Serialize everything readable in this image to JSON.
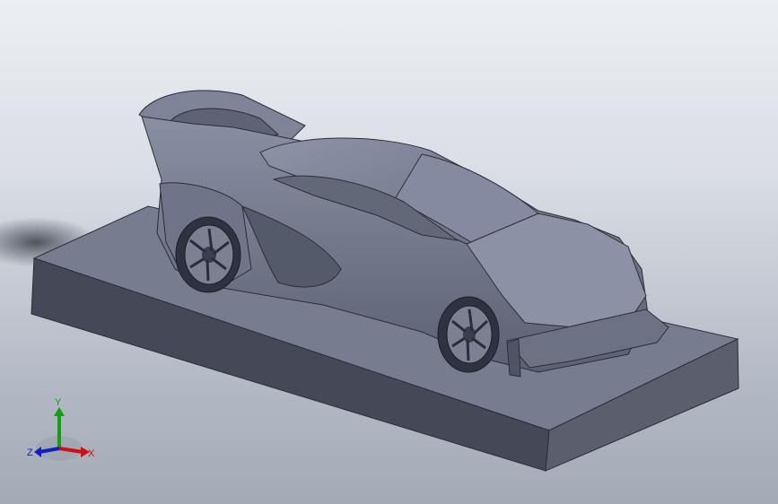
{
  "viewport": {
    "background_top": "#eceff3",
    "background_bottom": "#a3aab6",
    "model_color": "#767b8d"
  },
  "triad": {
    "x_label": "X",
    "y_label": "Y",
    "z_label": "Z",
    "x_color": "#d01010",
    "y_color": "#10a010",
    "z_color": "#1020c0"
  }
}
